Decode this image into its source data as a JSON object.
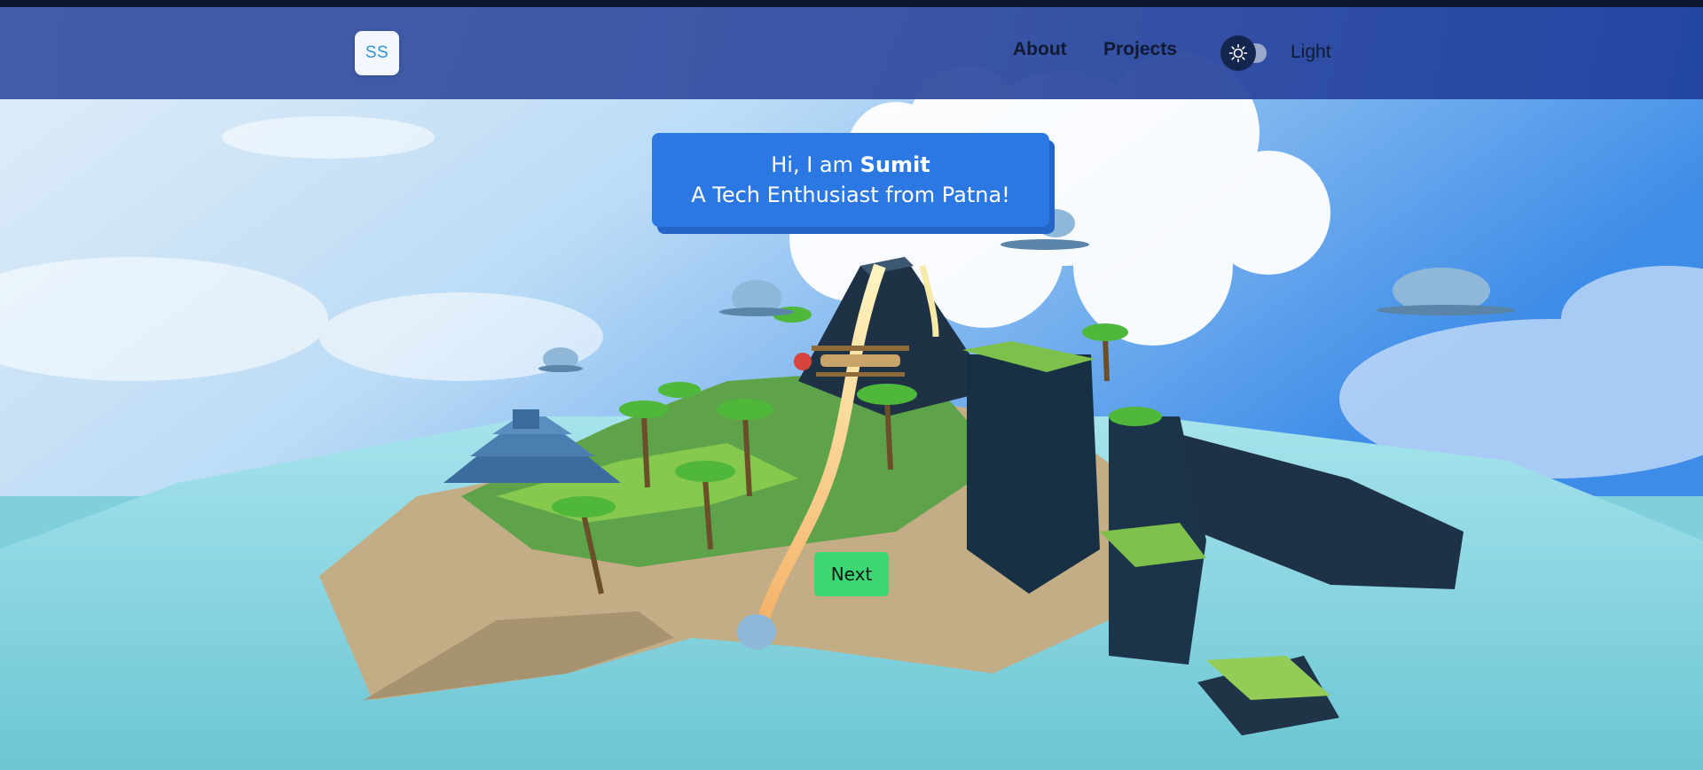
{
  "navbar": {
    "logo_text": "SS",
    "links": [
      {
        "label": "About"
      },
      {
        "label": "Projects"
      }
    ],
    "theme_toggle": {
      "label": "Light",
      "icon": "sun-icon",
      "state": "light"
    }
  },
  "hero": {
    "greeting_prefix": "Hi, I am ",
    "name": "Sumit",
    "tagline": "A Tech Enthusiast from Patna!"
  },
  "controls": {
    "next_label": "Next"
  },
  "colors": {
    "navbar": "#3c58a5",
    "greeting_box": "#2b78e2",
    "next_button": "#3fd676",
    "sea": "#7fd0dc",
    "sky": "#5fb4ec"
  }
}
